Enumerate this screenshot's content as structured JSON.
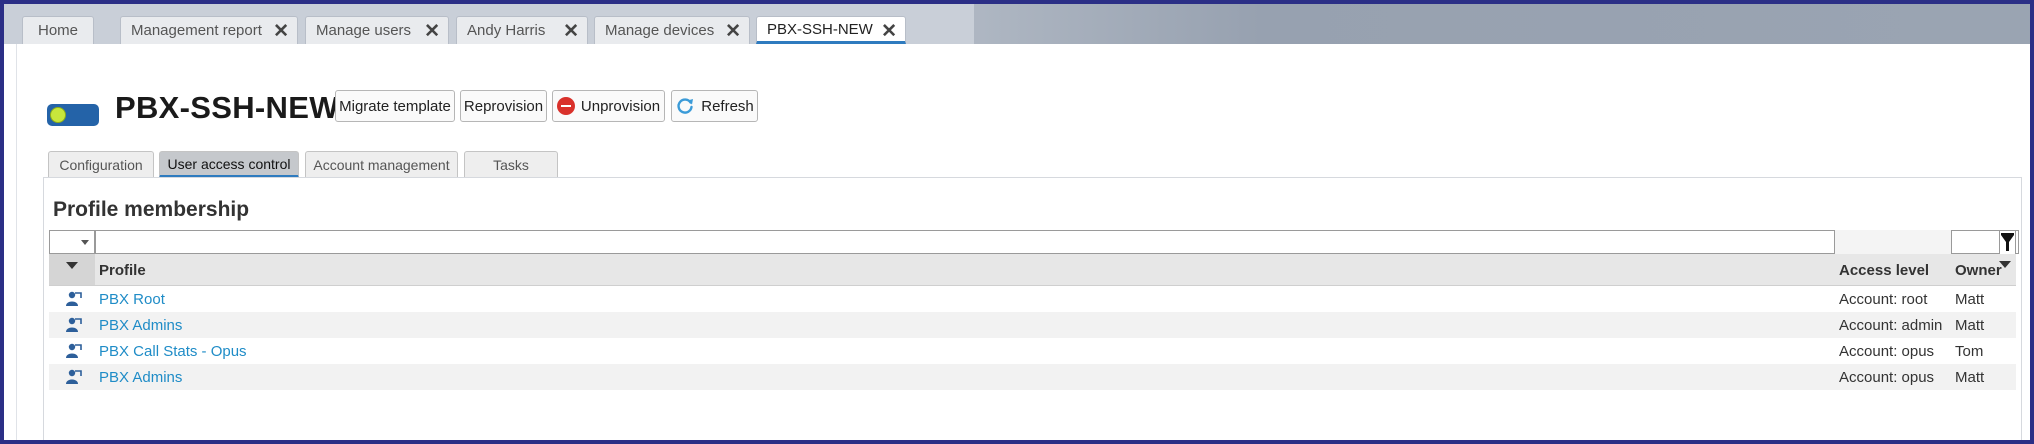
{
  "tabs": [
    {
      "label": "Home",
      "closable": false
    },
    {
      "label": "Management report",
      "closable": true
    },
    {
      "label": "Manage users",
      "closable": true
    },
    {
      "label": "Andy Harris",
      "closable": true
    },
    {
      "label": "Manage devices",
      "closable": true
    },
    {
      "label": "PBX-SSH-NEW",
      "closable": true,
      "active": true
    }
  ],
  "close_glyph": "✕",
  "header": {
    "title": "PBX-SSH-NEW",
    "toggle_state": "on",
    "buttons": {
      "migrate": "Migrate template",
      "reprovision": "Reprovision",
      "unprovision": "Unprovision",
      "refresh": "Refresh"
    }
  },
  "sub_tabs": [
    {
      "label": "Configuration"
    },
    {
      "label": "User access control",
      "active": true
    },
    {
      "label": "Account management"
    },
    {
      "label": "Tasks"
    }
  ],
  "section": {
    "title": "Profile membership"
  },
  "table": {
    "columns": {
      "profile": "Profile",
      "access_level": "Access level",
      "owner": "Owner"
    },
    "filter_profile_value": "",
    "rows": [
      {
        "profile": "PBX Root",
        "access_level": "Account: root",
        "owner": "Matt"
      },
      {
        "profile": "PBX Admins",
        "access_level": "Account: admin",
        "owner": "Matt"
      },
      {
        "profile": "PBX Call Stats - Opus",
        "access_level": "Account: opus",
        "owner": "Tom"
      },
      {
        "profile": "PBX Admins",
        "access_level": "Account: opus",
        "owner": "Matt"
      }
    ]
  },
  "colors": {
    "link": "#1f8cc7",
    "accent": "#2e7bbf",
    "toggle_on": "#c7e63c",
    "unprovision_red": "#d9312b"
  },
  "icons": {
    "row": "profile-user-icon",
    "refresh": "refresh-icon",
    "unprovision": "stop-icon",
    "filter": "filter-icon"
  }
}
